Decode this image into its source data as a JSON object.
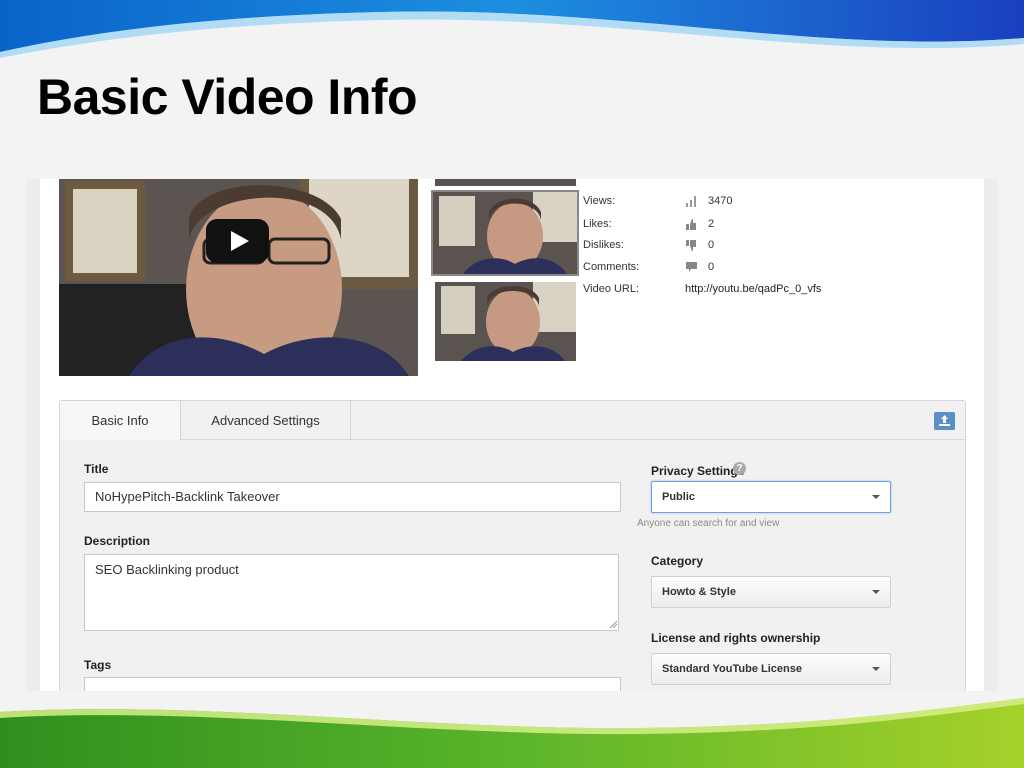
{
  "slide": {
    "title": "Basic Video Info",
    "colors": {
      "top_wave": "#1e4fc4",
      "bottom_wave": "#4cae2a"
    }
  },
  "player": {
    "play_button_icon": "play-icon"
  },
  "stats": {
    "views_label": "Views:",
    "views_value": "3470",
    "views_icon": "bar-chart-icon",
    "likes_label": "Likes:",
    "likes_value": "2",
    "likes_icon": "thumbs-up-icon",
    "dislikes_label": "Dislikes:",
    "dislikes_value": "0",
    "dislikes_icon": "thumbs-down-icon",
    "comments_label": "Comments:",
    "comments_value": "0",
    "comments_icon": "comment-icon",
    "url_label": "Video URL:",
    "url_value": "http://youtu.be/qadPc_0_vfs"
  },
  "tabs": {
    "basic_info": "Basic Info",
    "advanced_settings": "Advanced Settings",
    "upload_icon": "upload-icon"
  },
  "form": {
    "title_label": "Title",
    "title_value": "NoHypePitch-Backlink Takeover",
    "description_label": "Description",
    "description_value": "SEO Backlinking product",
    "tags_label": "Tags",
    "tags_value": "",
    "privacy_label": "Privacy Settings",
    "privacy_help_icon": "help-icon",
    "privacy_value": "Public",
    "privacy_hint": "Anyone can search for and view",
    "category_label": "Category",
    "category_value": "Howto & Style",
    "license_label": "License and rights ownership",
    "license_value": "Standard YouTube License"
  }
}
